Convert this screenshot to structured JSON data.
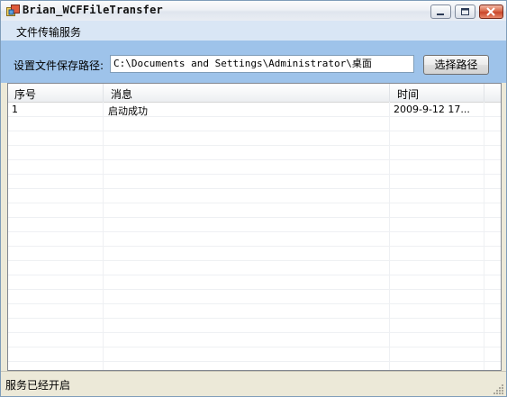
{
  "window": {
    "title": "Brian_WCFFileTransfer"
  },
  "menu": {
    "items": [
      "文件传输服务"
    ]
  },
  "path": {
    "label": "设置文件保存路径:",
    "value": "C:\\Documents and Settings\\Administrator\\桌面",
    "button_label": "选择路径"
  },
  "list": {
    "columns": [
      "序号",
      "消息",
      "时间"
    ],
    "rows": [
      {
        "index": "1",
        "message": "启动成功",
        "time": "2009-9-12 17..."
      }
    ]
  },
  "status": {
    "text": "服务已经开启"
  },
  "colors": {
    "menu_bg": "#d9e6f5",
    "panel_bg": "#9ec3ea",
    "close_button": "#c9462a"
  }
}
